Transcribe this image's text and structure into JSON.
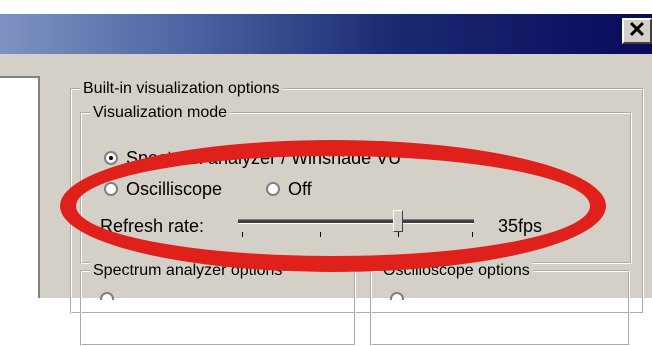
{
  "window": {
    "close_label": "✕"
  },
  "groups": {
    "builtin": "Built-in visualization options",
    "vizmode": "Visualization mode",
    "spectrum_options": "Spectrum analyzer options",
    "oscilloscope_options": "Oscilloscope options"
  },
  "vizmode": {
    "options": [
      {
        "label": "Spectrum analyzer / Winshade VU",
        "checked": true
      },
      {
        "label": "Oscilliscope",
        "checked": false
      },
      {
        "label": "Off",
        "checked": false
      }
    ],
    "refresh_label": "Refresh rate:",
    "refresh_value": "35fps",
    "refresh_fraction": 0.68
  },
  "colors": {
    "highlight": "#e0201a",
    "titlebar_end": "#0a0a5a",
    "dialog_bg": "#d4d0c8"
  }
}
